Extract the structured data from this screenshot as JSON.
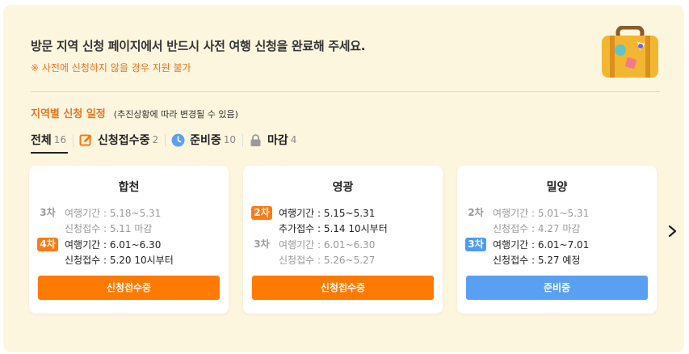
{
  "notice": {
    "title": "방문 지역 신청 페이지에서 반드시 사전 여행 신청을 완료해 주세요.",
    "warning": "※ 사전에 신청하지 않을 경우 지원 불가"
  },
  "schedule": {
    "title": "지역별 신청 일정",
    "note": "(추진상황에 따라 변경될 수 있음)"
  },
  "filters": [
    {
      "label": "전체",
      "count": "16",
      "icon": ""
    },
    {
      "label": "신청접수중",
      "count": "2",
      "icon": "pencil-edit-icon"
    },
    {
      "label": "준비중",
      "count": "10",
      "icon": "clock-icon"
    },
    {
      "label": "마감",
      "count": "4",
      "icon": "lock-icon"
    }
  ],
  "cards": [
    {
      "region": "합천",
      "rounds": [
        {
          "badge": "3차",
          "lines": [
            "여행기간 : 5.18~5.31",
            "신청접수 : 5.11 마감"
          ]
        },
        {
          "badge": "4차",
          "lines": [
            "여행기간 : 6.01~6.30",
            "신청접수 : 5.20 10시부터"
          ]
        }
      ],
      "button": "신청접수중"
    },
    {
      "region": "영광",
      "rounds": [
        {
          "badge": "2차",
          "lines": [
            "여행기간 : 5.15~5.31",
            "추가접수 : 5.14 10시부터"
          ]
        },
        {
          "badge": "3차",
          "lines": [
            "여행기간 : 6.01~6.30",
            "신청접수 : 5.26~5.27"
          ]
        }
      ],
      "button": "신청접수중"
    },
    {
      "region": "밀양",
      "rounds": [
        {
          "badge": "2차",
          "lines": [
            "여행기간 : 5.01~5.31",
            "신청접수 : 4.27 마감"
          ]
        },
        {
          "badge": "3차",
          "lines": [
            "여행기간 : 6.01~7.01",
            "신청접수 : 5.27 예정"
          ]
        }
      ],
      "button": "준비중"
    }
  ],
  "colors": {
    "accent_orange": "#ff7a00",
    "accent_blue": "#5aa0f2",
    "panel_bg": "#fdf6df"
  },
  "icons": {
    "illustration": "suitcase-icon",
    "next": "chevron-right-icon"
  }
}
